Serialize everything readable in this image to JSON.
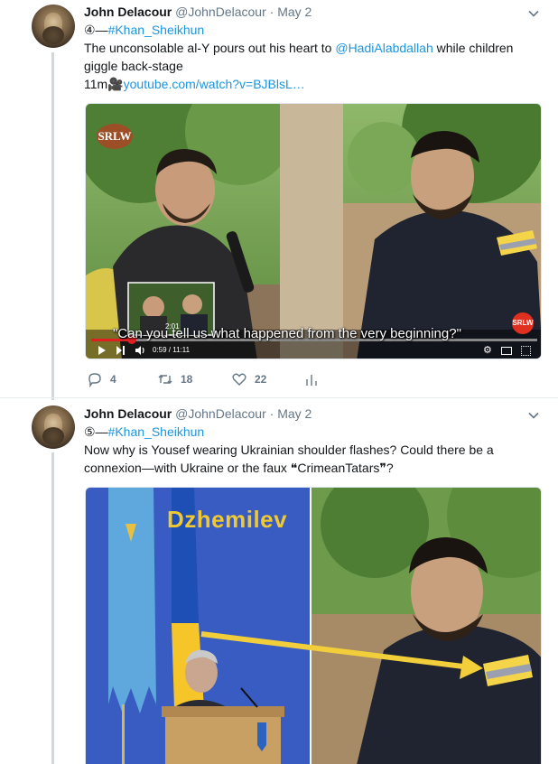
{
  "tweets": [
    {
      "author_name": "John Delacour",
      "author_handle": "@JohnDelacour",
      "separator": "·",
      "date": "May 2",
      "line1_prefix": "④—",
      "line1_hashtag": "#Khan_Sheikhun",
      "body_before": "The unconsolable al-Y pours out his heart to ",
      "body_mention": "@HadiAlabdallah",
      "body_after": " while children giggle back-stage",
      "line3_prefix": "11m🎥",
      "line3_link": "youtube.com/watch?v=BJBlsL…",
      "video": {
        "logo": "SRLW",
        "logo_right": "SRLW",
        "caption": "\"Can you tell us what happened from the very beginning?\"",
        "thumb_time": "2:01",
        "elapsed": "0:59 / 11:11"
      },
      "replies": "4",
      "retweets": "18",
      "likes": "22"
    },
    {
      "author_name": "John Delacour",
      "author_handle": "@JohnDelacour",
      "separator": "·",
      "date": "May 2",
      "line1_prefix": "⑤—",
      "line1_hashtag": "#Khan_Sheikhun",
      "body_before": "Now why is Yousef wearing Ukrainian shoulder flashes? Could there be a connexion—with Ukraine or the faux ",
      "body_quote": "❝CrimeanTatars❞",
      "body_after": "?",
      "image_label": "Dzhemilev"
    }
  ],
  "colors": {
    "link": "#1b95e0",
    "muted": "#657786",
    "arrow": "#f2cf3a"
  }
}
